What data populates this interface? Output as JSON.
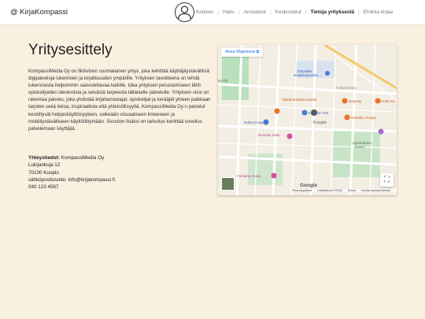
{
  "header": {
    "brand": "@ KirjaKompassi",
    "nav": [
      {
        "label": "Kotisivu",
        "active": false
      },
      {
        "label": "Haku",
        "active": false
      },
      {
        "label": "Arvostelut",
        "active": false
      },
      {
        "label": "Keskustelut",
        "active": false
      },
      {
        "label": "Tietoja yrityksestä",
        "active": true
      },
      {
        "label": "Ehdota kirjaa",
        "active": false
      }
    ]
  },
  "main": {
    "title": "Yritysesittely",
    "description": "KompassiMedia Oy on fiktiivinen suomalainen yritys, joka kehittää käyttäjäystävällisiä digipalveluja lukemisen ja kirjallisuuden ympärille. Yrityksen tavoitteena on tehdä lukemisesta helpommin saavutettavaa kaikille. Idea yrityksen perustamiseen lähti opiskelijoiden ideoinnista ja selvästä tarpeesta tällaiselle palvelulle. Yrityksen visio on rakentaa palvelu, joka yhdistää kirjaharrastajat, opiskelijat ja kerääjät yhteen paikkaan tarjoten sekä tietoa, inspiraatiota että yhteisöllisyyttä. KompassiMedia Oy:n palvelut keskittyvät helppokäyttöisyyteen, selkeään visuaaliseen ilmeeseen ja mobiiliystävälliseen käyttöliittymään. Sivuston lisäksi on tarkoitus kehittää sovellus palvelemaan käyttäjiä.",
    "contact": {
      "heading": "Yhteystiedot:",
      "company": "KompassiMedia Oy",
      "street": "Lukijankuja 12",
      "city": "70100 Kuopio",
      "email_line": "sähköpostiosoite: info@kirjakompassi.fi",
      "phone": "040 123 4567"
    }
  },
  "map": {
    "open_label": "Avaa Mapsissa",
    "labels": {
      "tori_parking": "Toriparkki",
      "tori_parking2": "sisäänajoluiska...",
      "tulliportinkatu": "Tulliportinkatu",
      "viking": "Vikinkravintola Harald",
      "subway": "Subway",
      "hook": "Hook Ku",
      "tori": "Kuopion Tori",
      "amarillo": "Amarillo, Kuopio",
      "sokos": "Sokos Kuopio",
      "kuopio": "Kuopio",
      "scandic": "Scandic Atlas",
      "finnkino": "Finnkino Scala",
      "lapinlahti": "Lapinlahden",
      "lapinlahti2": "puisto",
      "ipu": "ipu-llo"
    },
    "google": "Google",
    "attribution": [
      "Pikanäppäimet",
      "Karttatiedot ©2026",
      "Ehdot",
      "Ilmoita karttavirheestä"
    ]
  }
}
